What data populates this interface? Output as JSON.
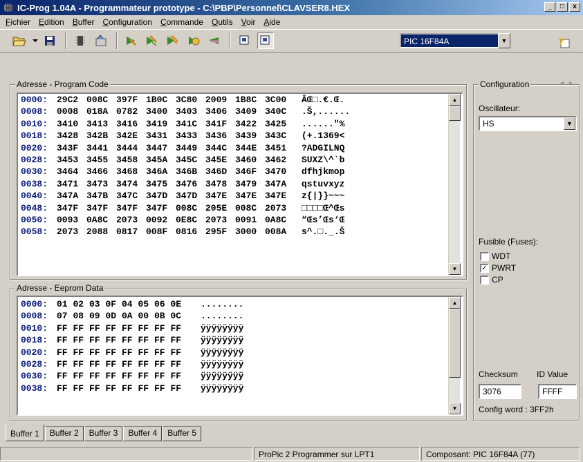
{
  "window": {
    "title": "IC-Prog 1.04A - Programmateur prototype - C:\\PBP\\Personnel\\CLAVSER8.HEX",
    "minimize": "_",
    "maximize": "□",
    "close": "x"
  },
  "menu": [
    {
      "ul": "F",
      "rest": "ichier"
    },
    {
      "ul": "E",
      "rest": "dition"
    },
    {
      "ul": "B",
      "rest": "uffer"
    },
    {
      "ul": "C",
      "rest": "onfiguration"
    },
    {
      "ul": "C",
      "rest": "ommande"
    },
    {
      "ul": "O",
      "rest": "utils"
    },
    {
      "ul": "V",
      "rest": "oir"
    },
    {
      "ul": "A",
      "rest": "ide"
    }
  ],
  "toolbar": {
    "device": "PIC 16F84A",
    "icons": [
      "open-icon",
      "dropdown-arrow-icon",
      "save-icon",
      "read-device-icon",
      "write-settings-icon",
      "program-icon",
      "program-all-icon",
      "verify-icon",
      "erase-icon",
      "blank-check-icon",
      "view-buffer-icon",
      "view-buffer-alt-icon",
      "help-icon"
    ]
  },
  "program_code": {
    "label": "Adresse - Program Code",
    "rows": [
      {
        "addr": "0000:",
        "words": [
          "29C2",
          "008C",
          "397F",
          "1B0C",
          "3C80",
          "2009",
          "1B8C",
          "3C00"
        ],
        "ascii": "ÂŒ□.€.Œ."
      },
      {
        "addr": "0008:",
        "words": [
          "0008",
          "018A",
          "0782",
          "3400",
          "3403",
          "3406",
          "3409",
          "340C"
        ],
        "ascii": ".Š,......"
      },
      {
        "addr": "0010:",
        "words": [
          "3410",
          "3413",
          "3416",
          "3419",
          "341C",
          "341F",
          "3422",
          "3425"
        ],
        "ascii": "......\"%"
      },
      {
        "addr": "0018:",
        "words": [
          "3428",
          "342B",
          "342E",
          "3431",
          "3433",
          "3436",
          "3439",
          "343C"
        ],
        "ascii": "(+.1369<"
      },
      {
        "addr": "0020:",
        "words": [
          "343F",
          "3441",
          "3444",
          "3447",
          "3449",
          "344C",
          "344E",
          "3451"
        ],
        "ascii": "?ADGILNQ"
      },
      {
        "addr": "0028:",
        "words": [
          "3453",
          "3455",
          "3458",
          "345A",
          "345C",
          "345E",
          "3460",
          "3462"
        ],
        "ascii": "SUXZ\\^`b"
      },
      {
        "addr": "0030:",
        "words": [
          "3464",
          "3466",
          "3468",
          "346A",
          "346B",
          "346D",
          "346F",
          "3470"
        ],
        "ascii": "dfhjkmop"
      },
      {
        "addr": "0038:",
        "words": [
          "3471",
          "3473",
          "3474",
          "3475",
          "3476",
          "3478",
          "3479",
          "347A"
        ],
        "ascii": "qstuvxyz"
      },
      {
        "addr": "0040:",
        "words": [
          "347A",
          "347B",
          "347C",
          "347D",
          "347D",
          "347E",
          "347E",
          "347E"
        ],
        "ascii": "z{|}}~~~"
      },
      {
        "addr": "0048:",
        "words": [
          "347F",
          "347F",
          "347F",
          "347F",
          "008C",
          "205E",
          "008C",
          "2073"
        ],
        "ascii": "□□□□Œ^Œs"
      },
      {
        "addr": "0050:",
        "words": [
          "0093",
          "0A8C",
          "2073",
          "0092",
          "0E8C",
          "2073",
          "0091",
          "0A8C"
        ],
        "ascii": "“Œs’Œs‘Œ"
      },
      {
        "addr": "0058:",
        "words": [
          "2073",
          "2088",
          "0817",
          "008F",
          "0816",
          "295F",
          "3000",
          "008A"
        ],
        "ascii": "s^.□._.Š"
      }
    ]
  },
  "eeprom": {
    "label": "Adresse - Eeprom Data",
    "rows": [
      {
        "addr": "0000:",
        "bytes": [
          "01",
          "02",
          "03",
          "0F",
          "04",
          "05",
          "06",
          "0E"
        ],
        "ascii": "........"
      },
      {
        "addr": "0008:",
        "bytes": [
          "07",
          "08",
          "09",
          "0D",
          "0A",
          "00",
          "0B",
          "0C"
        ],
        "ascii": "........"
      },
      {
        "addr": "0010:",
        "bytes": [
          "FF",
          "FF",
          "FF",
          "FF",
          "FF",
          "FF",
          "FF",
          "FF"
        ],
        "ascii": "ÿÿÿÿÿÿÿÿ"
      },
      {
        "addr": "0018:",
        "bytes": [
          "FF",
          "FF",
          "FF",
          "FF",
          "FF",
          "FF",
          "FF",
          "FF"
        ],
        "ascii": "ÿÿÿÿÿÿÿÿ"
      },
      {
        "addr": "0020:",
        "bytes": [
          "FF",
          "FF",
          "FF",
          "FF",
          "FF",
          "FF",
          "FF",
          "FF"
        ],
        "ascii": "ÿÿÿÿÿÿÿÿ"
      },
      {
        "addr": "0028:",
        "bytes": [
          "FF",
          "FF",
          "FF",
          "FF",
          "FF",
          "FF",
          "FF",
          "FF"
        ],
        "ascii": "ÿÿÿÿÿÿÿÿ"
      },
      {
        "addr": "0030:",
        "bytes": [
          "FF",
          "FF",
          "FF",
          "FF",
          "FF",
          "FF",
          "FF",
          "FF"
        ],
        "ascii": "ÿÿÿÿÿÿÿÿ"
      },
      {
        "addr": "0038:",
        "bytes": [
          "FF",
          "FF",
          "FF",
          "FF",
          "FF",
          "FF",
          "FF",
          "FF"
        ],
        "ascii": "ÿÿÿÿÿÿÿÿ"
      }
    ]
  },
  "config": {
    "title": "Configuration",
    "oscillator_label": "Oscillateur:",
    "oscillator_value": "HS",
    "fuses_label": "Fusible (Fuses):",
    "fuses": [
      {
        "label": "WDT",
        "checked": false
      },
      {
        "label": "PWRT",
        "checked": true
      },
      {
        "label": "CP",
        "checked": false
      }
    ],
    "checksum_label": "Checksum",
    "checksum_value": "3076",
    "id_label": "ID Value",
    "id_value": "FFFF",
    "config_word": "Config word : 3FF2h"
  },
  "tabs": [
    "Buffer 1",
    "Buffer 2",
    "Buffer 3",
    "Buffer 4",
    "Buffer 5"
  ],
  "status": {
    "programmer": "ProPic 2 Programmer sur LPT1",
    "device": "Composant: PIC 16F84A  (77)"
  }
}
